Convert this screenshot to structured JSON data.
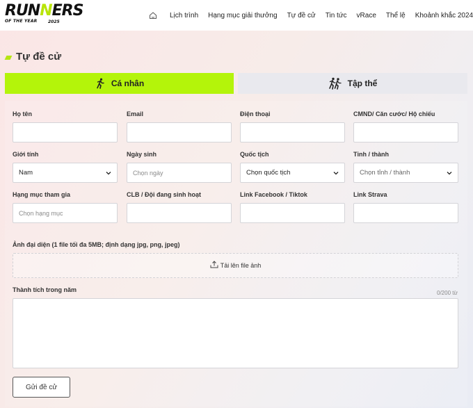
{
  "header": {
    "logo": {
      "main_a": "RUN",
      "main_accent": "N",
      "main_b": "ERS",
      "sub": "OF THE YEAR",
      "year": "2025"
    },
    "nav": [
      "Lịch trình",
      "Hạng mục giải thưởng",
      "Tự đề cử",
      "Tin tức",
      "vRace",
      "Thể lệ",
      "Khoảnh khắc 2024"
    ]
  },
  "page": {
    "title": "Tự đề cử"
  },
  "tabs": {
    "individual": "Cá nhân",
    "team": "Tập thể"
  },
  "form": {
    "row1": {
      "name_label": "Họ tên",
      "email_label": "Email",
      "phone_label": "Điện thoại",
      "id_label": "CMND/ Căn cước/ Hộ chiếu"
    },
    "row2": {
      "gender_label": "Giới tính",
      "gender_value": "Nam",
      "dob_label": "Ngày sinh",
      "dob_placeholder": "Chọn ngày",
      "nationality_label": "Quốc tịch",
      "nationality_value": "Chọn quốc tịch",
      "province_label": "Tỉnh / thành",
      "province_value": "Chọn tỉnh / thành"
    },
    "row3": {
      "category_label": "Hạng mục tham gia",
      "category_placeholder": "Chọn hạng mục",
      "club_label": "CLB / Đội đang sinh hoạt",
      "facebook_label": "Link Facebook / Tiktok",
      "strava_label": "Link Strava"
    },
    "avatar_label": "Ảnh đại diện (1 file tối đa 5MB; định dạng jpg, png, jpeg)",
    "upload_text": "Tải lên file ảnh",
    "achievements_label": "Thành tích trong năm",
    "counter": "0/200 từ",
    "submit_label": "Gửi đề cử"
  },
  "colors": {
    "accent": "#b4f40a",
    "tab_inactive": "#e9e9ee"
  }
}
